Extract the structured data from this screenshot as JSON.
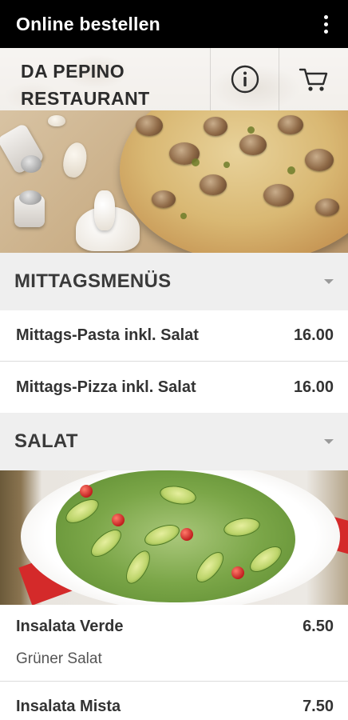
{
  "app_bar": {
    "title": "Online bestellen",
    "menu_icon": "more-vertical-icon"
  },
  "header": {
    "restaurant_name": "DA PEPINO RESTAURANT",
    "info_icon": "info-icon",
    "cart_icon": "cart-icon"
  },
  "categories": [
    {
      "title": "MITTAGSMENÜS",
      "items": [
        {
          "name": "Mittags-Pasta inkl. Salat",
          "price": "16.00"
        },
        {
          "name": "Mittags-Pizza inkl. Salat",
          "price": "16.00"
        }
      ]
    },
    {
      "title": "SALAT",
      "items": [
        {
          "name": "Insalata Verde",
          "price": "6.50",
          "description": "Grüner Salat"
        },
        {
          "name": "Insalata Mista",
          "price": "7.50"
        }
      ]
    }
  ]
}
